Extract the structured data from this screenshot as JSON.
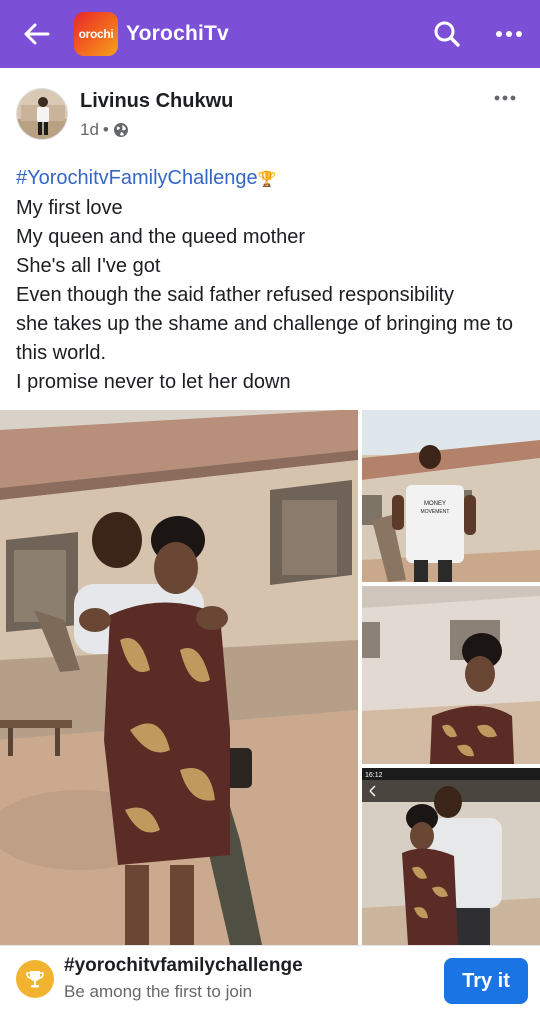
{
  "header": {
    "back_icon": "arrow-left-icon",
    "logo_text": "orochi",
    "group_name": "YorochiTv",
    "search_icon": "search-icon",
    "more_icon": "more-horizontal-icon",
    "background_color": "#7b4fd6"
  },
  "post": {
    "author": "Livinus Chukwu",
    "time": "1d",
    "separator": "•",
    "privacy_icon": "globe-icon",
    "more_icon": "more-horizontal-icon",
    "hashtag": "#YorochitvFamilyChallenge",
    "trophy_glyph": "🏆",
    "lines": [
      "My first love",
      "My queen and the queed mother",
      "She's all I've got",
      "Even though the said father refused responsibility",
      "she takes up the shame and challenge of bringing me to this world.",
      "I promise never to let her down"
    ],
    "photos": [
      {
        "name": "main-photo",
        "description": "couple-in-front-of-house"
      },
      {
        "name": "photo-man-standing"
      },
      {
        "name": "photo-woman-smiling"
      },
      {
        "name": "photo-screenshot-couple",
        "status_time": "16:12"
      }
    ],
    "shirt_text_line1": "MONEY",
    "shirt_text_line2": "MOVEMENT"
  },
  "challenge": {
    "icon": "trophy-icon",
    "title": "#yorochitvfamilychallenge",
    "subtitle": "Be among the first to join",
    "button_label": "Try it",
    "button_color": "#1b74e4"
  }
}
